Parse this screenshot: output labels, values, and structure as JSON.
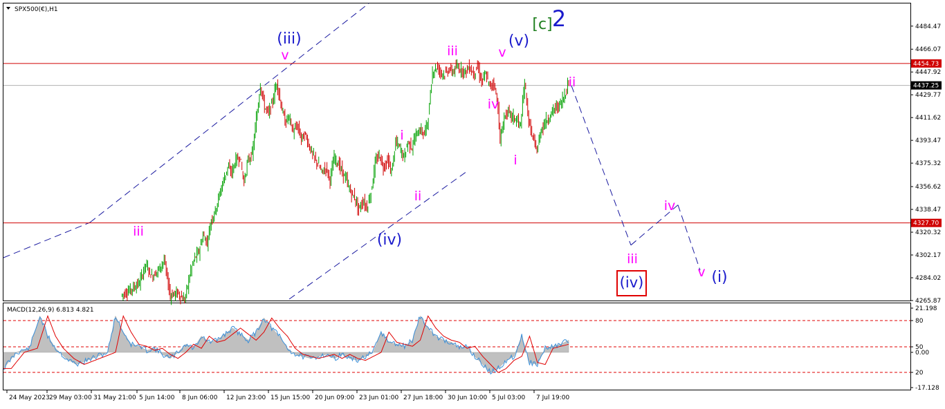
{
  "header": {
    "symbol_label": "SPX500(€),H1"
  },
  "colors": {
    "bull_candle": "#00a000",
    "bear_candle": "#d00000",
    "price_line": "#d00000",
    "projection": "#1a1aa0",
    "wave_minor": "#ff00ff",
    "wave_minute": "#1a1acc",
    "wave_green": "#208020",
    "macd_hist": "#c0c0c0",
    "macd_main": "#3a8fd9",
    "macd_signal": "#e00000",
    "level_line": "#e00000"
  },
  "chart_data": [
    {
      "type": "candlestick",
      "symbol": "SPX500(€)",
      "timeframe": "H1",
      "ylim": [
        4265.87,
        4502.52
      ],
      "y_ticks": [
        "4484.47",
        "4466.07",
        "4447.92",
        "4429.77",
        "4411.62",
        "4393.47",
        "4375.32",
        "4356.62",
        "4338.47",
        "4320.32",
        "4302.17",
        "4284.02",
        "4265.87"
      ],
      "x_ticks": [
        "24 May 2023",
        "29 May 03:00",
        "31 May 21:00",
        "5 Jun 14:00",
        "8 Jun 06:00",
        "12 Jun 23:00",
        "15 Jun 15:00",
        "20 Jun 09:00",
        "23 Jun 01:00",
        "27 Jun 18:00",
        "30 Jun 10:00",
        "5 Jul 03:00",
        "7 Jul 19:00"
      ],
      "price_lines": [
        {
          "value": 4454.73,
          "label": "4454.73"
        },
        {
          "value": 4327.7,
          "label": "4327.70"
        }
      ],
      "current_price": {
        "value": 4437.25,
        "label": "4437.25"
      },
      "price_path": [
        [
          0,
          4270
        ],
        [
          10,
          4275
        ],
        [
          18,
          4280
        ],
        [
          24,
          4295
        ],
        [
          30,
          4285
        ],
        [
          36,
          4290
        ],
        [
          42,
          4298
        ],
        [
          48,
          4270
        ],
        [
          55,
          4272
        ],
        [
          62,
          4266
        ],
        [
          68,
          4290
        ],
        [
          72,
          4300
        ],
        [
          76,
          4305
        ],
        [
          80,
          4318
        ],
        [
          84,
          4312
        ],
        [
          88,
          4330
        ],
        [
          92,
          4338
        ],
        [
          96,
          4350
        ],
        [
          100,
          4362
        ],
        [
          104,
          4372
        ],
        [
          108,
          4368
        ],
        [
          112,
          4378
        ],
        [
          116,
          4380
        ],
        [
          120,
          4360
        ],
        [
          124,
          4378
        ],
        [
          128,
          4382
        ],
        [
          132,
          4410
        ],
        [
          136,
          4438
        ],
        [
          140,
          4420
        ],
        [
          144,
          4415
        ],
        [
          148,
          4425
        ],
        [
          152,
          4440
        ],
        [
          156,
          4422
        ],
        [
          160,
          4408
        ],
        [
          164,
          4412
        ],
        [
          168,
          4400
        ],
        [
          172,
          4405
        ],
        [
          176,
          4395
        ],
        [
          180,
          4398
        ],
        [
          184,
          4388
        ],
        [
          188,
          4380
        ],
        [
          192,
          4375
        ],
        [
          196,
          4368
        ],
        [
          200,
          4372
        ],
        [
          204,
          4362
        ],
        [
          208,
          4380
        ],
        [
          212,
          4375
        ],
        [
          216,
          4368
        ],
        [
          220,
          4362
        ],
        [
          224,
          4352
        ],
        [
          228,
          4348
        ],
        [
          232,
          4338
        ],
        [
          236,
          4345
        ],
        [
          240,
          4340
        ],
        [
          244,
          4352
        ],
        [
          248,
          4375
        ],
        [
          252,
          4382
        ],
        [
          256,
          4372
        ],
        [
          260,
          4378
        ],
        [
          264,
          4368
        ],
        [
          268,
          4392
        ],
        [
          272,
          4388
        ],
        [
          276,
          4380
        ],
        [
          280,
          4392
        ],
        [
          284,
          4388
        ],
        [
          288,
          4398
        ],
        [
          292,
          4402
        ],
        [
          296,
          4398
        ],
        [
          300,
          4412
        ],
        [
          304,
          4448
        ],
        [
          308,
          4452
        ],
        [
          312,
          4448
        ],
        [
          316,
          4446
        ],
        [
          320,
          4450
        ],
        [
          324,
          4448
        ],
        [
          328,
          4452
        ],
        [
          332,
          4450
        ],
        [
          336,
          4448
        ],
        [
          340,
          4452
        ],
        [
          344,
          4446
        ],
        [
          348,
          4452
        ],
        [
          352,
          4440
        ],
        [
          356,
          4446
        ],
        [
          360,
          4436
        ],
        [
          364,
          4440
        ],
        [
          368,
          4420
        ],
        [
          370,
          4392
        ],
        [
          374,
          4412
        ],
        [
          378,
          4416
        ],
        [
          382,
          4412
        ],
        [
          386,
          4410
        ],
        [
          390,
          4405
        ],
        [
          394,
          4440
        ],
        [
          398,
          4408
        ],
        [
          402,
          4395
        ],
        [
          406,
          4385
        ],
        [
          410,
          4402
        ],
        [
          414,
          4408
        ],
        [
          418,
          4412
        ],
        [
          422,
          4418
        ],
        [
          426,
          4420
        ],
        [
          430,
          4424
        ],
        [
          434,
          4432
        ],
        [
          437,
          4440
        ]
      ],
      "series_x_range": [
        0,
        437
      ]
    },
    {
      "type": "line",
      "title": "MACD(12,26,9) 6.813 4.821",
      "ylim": [
        -17.128,
        21.198
      ],
      "y_ticks": [
        "21.198",
        "80",
        "50",
        "0.00",
        "20",
        "-17.128"
      ],
      "level_lines": [
        80,
        50,
        20
      ],
      "series_path": [
        [
          0,
          -8
        ],
        [
          10,
          0
        ],
        [
          20,
          2
        ],
        [
          28,
          18
        ],
        [
          34,
          8
        ],
        [
          40,
          2
        ],
        [
          48,
          -3
        ],
        [
          56,
          -6
        ],
        [
          64,
          -4
        ],
        [
          72,
          -2
        ],
        [
          80,
          0
        ],
        [
          86,
          18
        ],
        [
          92,
          10
        ],
        [
          98,
          4
        ],
        [
          104,
          3
        ],
        [
          110,
          1
        ],
        [
          116,
          2
        ],
        [
          122,
          -1
        ],
        [
          128,
          -3
        ],
        [
          134,
          0
        ],
        [
          140,
          4
        ],
        [
          146,
          2
        ],
        [
          152,
          8
        ],
        [
          158,
          5
        ],
        [
          164,
          6
        ],
        [
          170,
          9
        ],
        [
          176,
          12
        ],
        [
          182,
          9
        ],
        [
          188,
          6
        ],
        [
          194,
          10
        ],
        [
          200,
          17
        ],
        [
          206,
          12
        ],
        [
          212,
          8
        ],
        [
          218,
          2
        ],
        [
          224,
          -1
        ],
        [
          230,
          -2
        ],
        [
          236,
          -3
        ],
        [
          242,
          -2
        ],
        [
          248,
          -1
        ],
        [
          254,
          -3
        ],
        [
          260,
          -1
        ],
        [
          266,
          -3
        ],
        [
          272,
          -4
        ],
        [
          278,
          -2
        ],
        [
          284,
          0
        ],
        [
          290,
          10
        ],
        [
          296,
          5
        ],
        [
          302,
          4
        ],
        [
          308,
          3
        ],
        [
          314,
          6
        ],
        [
          320,
          18
        ],
        [
          326,
          12
        ],
        [
          332,
          8
        ],
        [
          338,
          6
        ],
        [
          344,
          5
        ],
        [
          350,
          2
        ],
        [
          356,
          3
        ],
        [
          362,
          -2
        ],
        [
          368,
          -6
        ],
        [
          374,
          -10
        ],
        [
          380,
          -8
        ],
        [
          386,
          -4
        ],
        [
          392,
          -2
        ],
        [
          398,
          8
        ],
        [
          404,
          -5
        ],
        [
          410,
          -6
        ],
        [
          416,
          2
        ],
        [
          422,
          3
        ],
        [
          428,
          4
        ],
        [
          434,
          6
        ]
      ]
    }
  ],
  "wave_labels": [
    {
      "id": "iii-blue",
      "text": "(iii)",
      "color": "minute"
    },
    {
      "id": "v-1",
      "text": "v",
      "color": "minor"
    },
    {
      "id": "iii-left",
      "text": "iii",
      "color": "minor"
    },
    {
      "id": "i-1",
      "text": "i",
      "color": "minor"
    },
    {
      "id": "ii-1",
      "text": "ii",
      "color": "minor"
    },
    {
      "id": "iv-blue",
      "text": "(iv)",
      "color": "minute"
    },
    {
      "id": "iii-top",
      "text": "iii",
      "color": "minor"
    },
    {
      "id": "v-2",
      "text": "v",
      "color": "minor"
    },
    {
      "id": "v-blue",
      "text": "(v)",
      "color": "minute"
    },
    {
      "id": "c-green",
      "text": "[c]",
      "color": "green"
    },
    {
      "id": "two",
      "text": "2",
      "color": "minute"
    },
    {
      "id": "iv-1",
      "text": "iv",
      "color": "minor"
    },
    {
      "id": "i-2",
      "text": "i",
      "color": "minor"
    },
    {
      "id": "ii-2",
      "text": "ii",
      "color": "minor"
    },
    {
      "id": "iii-proj",
      "text": "iii",
      "color": "minor"
    },
    {
      "id": "iv-boxed",
      "text": "(iv)",
      "color": "minute"
    },
    {
      "id": "iv-proj",
      "text": "iv",
      "color": "minor"
    },
    {
      "id": "v-proj",
      "text": "v",
      "color": "minor"
    },
    {
      "id": "i-blue",
      "text": "(i)",
      "color": "minute"
    }
  ],
  "projection_path": [
    {
      "label": "ii",
      "price": 4437
    },
    {
      "label": "iii",
      "price": 4310
    },
    {
      "label": "iv",
      "price": 4342
    },
    {
      "label": "v",
      "price": 4290
    }
  ]
}
